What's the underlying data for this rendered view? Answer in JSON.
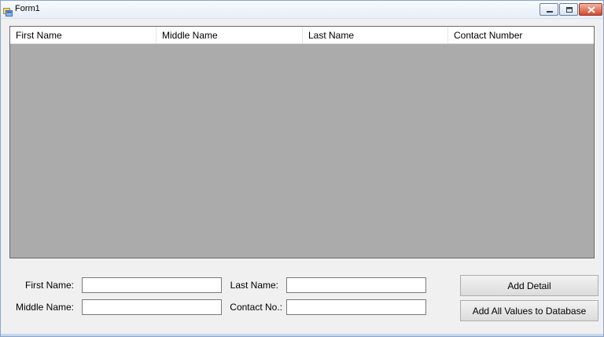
{
  "window": {
    "title": "Form1",
    "icons": {
      "app": "app-form-icon",
      "minimize": "minimize-icon",
      "maximize": "maximize-icon",
      "close": "close-icon"
    }
  },
  "grid": {
    "columns": [
      "First Name",
      "Middle Name",
      "Last Name",
      "Contact Number"
    ],
    "rows": []
  },
  "form": {
    "first_name_label": "First Name:",
    "middle_name_label": "Middle Name:",
    "last_name_label": "Last Name:",
    "contact_label": "Contact No.:",
    "first_name_value": "",
    "middle_name_value": "",
    "last_name_value": "",
    "contact_value": ""
  },
  "buttons": {
    "add_detail": "Add Detail",
    "add_all": "Add All Values to Database"
  },
  "colors": {
    "grid_background": "#ababab",
    "close_button": "#d24a2d"
  }
}
